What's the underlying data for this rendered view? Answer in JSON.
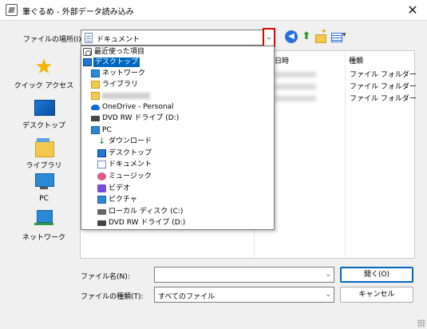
{
  "window": {
    "title": "筆ぐるめ - 外部データ読み込み",
    "close_glyph": "✕"
  },
  "location": {
    "label": "ファイルの場所(I):",
    "value": "ドキュメント",
    "arrow": "⌄"
  },
  "toolbar": {
    "back_glyph": "◀",
    "up_glyph": "⬆"
  },
  "places": [
    {
      "label": "クイック アクセス",
      "icon": "star-icon"
    },
    {
      "label": "デスクトップ",
      "icon": "desktop-icon"
    },
    {
      "label": "ライブラリ",
      "icon": "library-icon"
    },
    {
      "label": "PC",
      "icon": "pc-icon"
    },
    {
      "label": "ネットワーク",
      "icon": "network-icon"
    }
  ],
  "columns": {
    "date": "日時",
    "type": "種類"
  },
  "file_types": [
    "ファイル フォルダー",
    "ファイル フォルダー",
    "ファイル フォルダー"
  ],
  "dropdown": {
    "items": [
      {
        "label": "最近使った項目",
        "icon": "recent-icon",
        "level": 0,
        "selected": false
      },
      {
        "label": "デスクトップ",
        "icon": "desktop-icon",
        "level": 0,
        "selected": true
      },
      {
        "label": "ネットワーク",
        "icon": "network-icon",
        "level": 1,
        "selected": false
      },
      {
        "label": "ライブラリ",
        "icon": "folder-icon",
        "level": 1,
        "selected": false
      },
      {
        "label": "",
        "icon": "blurred-folder-icon",
        "level": 1,
        "selected": false
      },
      {
        "label": "OneDrive - Personal",
        "icon": "cloud-icon",
        "level": 1,
        "selected": false
      },
      {
        "label": "DVD RW ドライブ (D:)",
        "icon": "dvd-drive-icon",
        "level": 1,
        "selected": false
      },
      {
        "label": "PC",
        "icon": "pc-icon",
        "level": 1,
        "selected": false
      },
      {
        "label": "ダウンロード",
        "icon": "download-icon",
        "level": 2,
        "selected": false
      },
      {
        "label": "デスクトップ",
        "icon": "desktop-icon",
        "level": 2,
        "selected": false
      },
      {
        "label": "ドキュメント",
        "icon": "documents-icon",
        "level": 2,
        "selected": false
      },
      {
        "label": "ミュージック",
        "icon": "music-icon",
        "level": 2,
        "selected": false
      },
      {
        "label": "ビデオ",
        "icon": "video-icon",
        "level": 2,
        "selected": false
      },
      {
        "label": "ピクチャ",
        "icon": "pictures-icon",
        "level": 2,
        "selected": false
      },
      {
        "label": "ローカル ディスク (C:)",
        "icon": "local-disk-icon",
        "level": 2,
        "selected": false
      },
      {
        "label": "DVD RW ドライブ (D:)",
        "icon": "dvd-drive-icon",
        "level": 2,
        "selected": false
      }
    ]
  },
  "filename": {
    "label": "ファイル名(N):",
    "value": "",
    "arrow": "⌄"
  },
  "filetype": {
    "label": "ファイルの種類(T):",
    "value": "すべてのファイル",
    "arrow": "⌄"
  },
  "buttons": {
    "open": "開く(O)",
    "cancel": "キャンセル"
  }
}
